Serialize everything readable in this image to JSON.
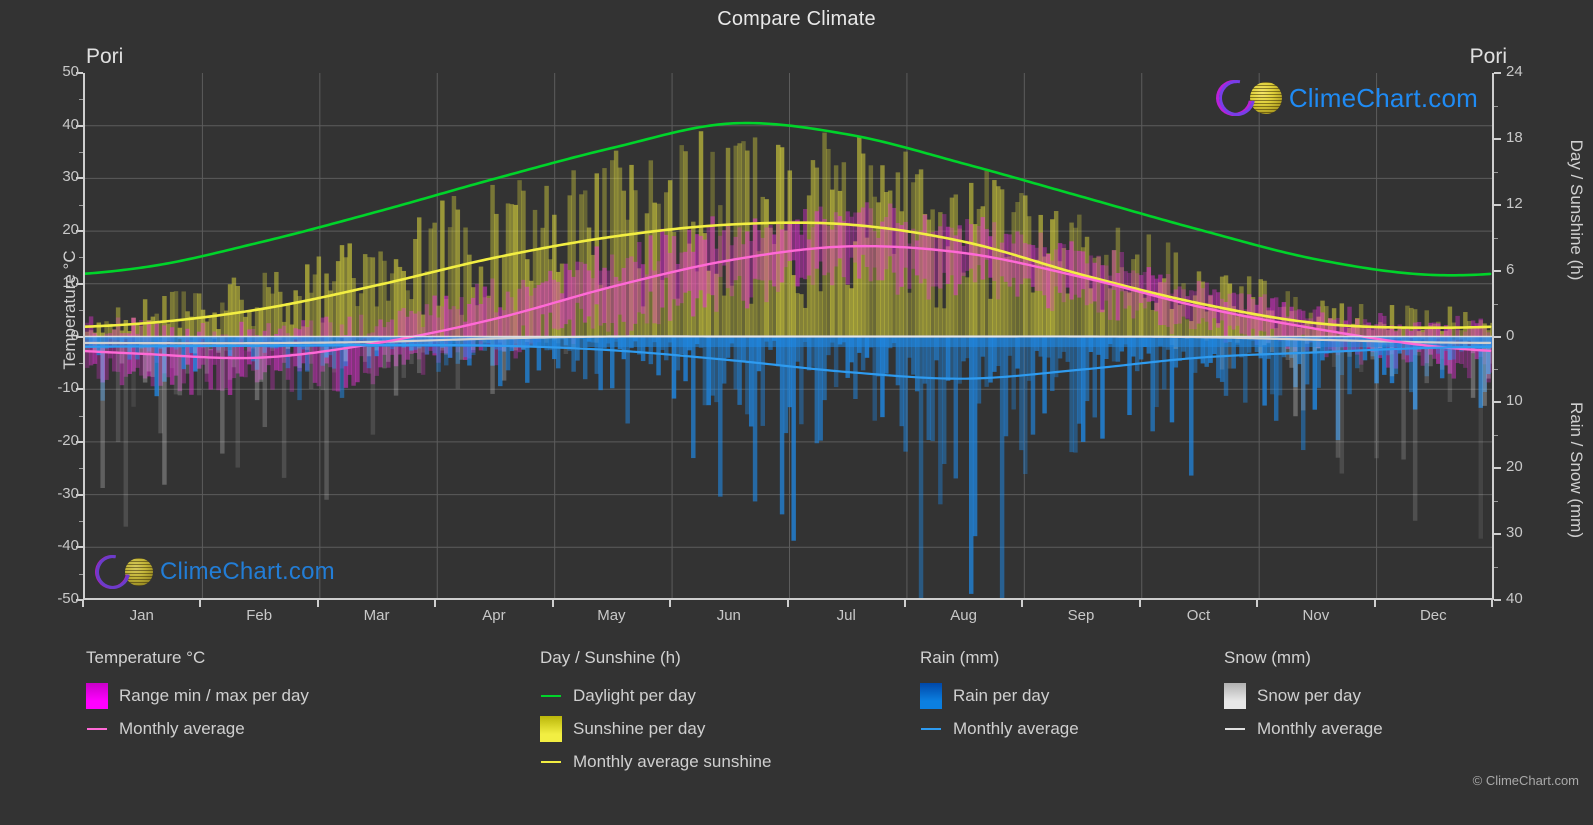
{
  "title": "Compare Climate",
  "location_left": "Pori",
  "location_right": "Pori",
  "copyright": "© ClimeChart.com",
  "watermark": {
    "text": "ClimeChart.com"
  },
  "axes": {
    "left_title": "Temperature °C",
    "right_title_top": "Day / Sunshine (h)",
    "right_title_bottom": "Rain / Snow (mm)",
    "left_ticks": [
      "50",
      "40",
      "30",
      "20",
      "10",
      "0",
      "-10",
      "-20",
      "-30",
      "-40",
      "-50"
    ],
    "right_ticks_top": [
      "24",
      "18",
      "12",
      "6",
      "0"
    ],
    "right_ticks_bottom": [
      "0",
      "10",
      "20",
      "30",
      "40"
    ],
    "x_ticks": [
      "Jan",
      "Feb",
      "Mar",
      "Apr",
      "May",
      "Jun",
      "Jul",
      "Aug",
      "Sep",
      "Oct",
      "Nov",
      "Dec"
    ]
  },
  "legend": [
    {
      "heading": "Temperature °C",
      "entries": [
        {
          "label": "Range min / max per day",
          "mark": "gradient",
          "color": "#ff00ff"
        },
        {
          "label": "Monthly average",
          "mark": "line",
          "color": "#ff69d6"
        }
      ]
    },
    {
      "heading": "Day / Sunshine (h)",
      "entries": [
        {
          "label": "Daylight per day",
          "mark": "line",
          "color": "#00d42a"
        },
        {
          "label": "Sunshine per day",
          "mark": "gradient",
          "color": "#f2ee42"
        },
        {
          "label": "Monthly average sunshine",
          "mark": "line",
          "color": "#f2ee42"
        }
      ]
    },
    {
      "heading": "Rain (mm)",
      "entries": [
        {
          "label": "Rain per day",
          "mark": "gradient",
          "color": "#0b7fe0"
        },
        {
          "label": "Monthly average",
          "mark": "line",
          "color": "#2e9bf0"
        }
      ]
    },
    {
      "heading": "Snow (mm)",
      "entries": [
        {
          "label": "Snow per day",
          "mark": "gradient",
          "color": "#e8e8e8"
        },
        {
          "label": "Monthly average",
          "mark": "line",
          "color": "#e0e0e0"
        }
      ]
    }
  ],
  "colors": {
    "background": "#333333",
    "plot_background": "#333333",
    "grid": "#5c5c5c",
    "axis": "#cfcfcf",
    "text": "#c8c8c8",
    "daylight": "#00d42a",
    "sunshine": "#f2ee42",
    "temperature_avg": "#ff69d6",
    "temperature_range": "#ff00ff",
    "rain": "#1f8ae8",
    "rain_avg": "#2e9bf0",
    "snow": "#cfcfcf",
    "logo_blue": "#1e90ff",
    "logo_magenta": "#c21fe0"
  },
  "chart_data": {
    "type": "line",
    "title": "Compare Climate",
    "subtitle": "Pori",
    "xlabel": "",
    "ylabel": "Temperature °C",
    "ylim": [
      -50,
      50
    ],
    "y2lim_day_sunshine": [
      0,
      24
    ],
    "y2lim_rain_snow": [
      0,
      40
    ],
    "grid": true,
    "legend_position": "bottom",
    "x": [
      "Jan",
      "Feb",
      "Mar",
      "Apr",
      "May",
      "Jun",
      "Jul",
      "Aug",
      "Sep",
      "Oct",
      "Nov",
      "Dec"
    ],
    "series": [
      {
        "name": "Daylight per day",
        "unit": "h",
        "axis": "day_sunshine",
        "color": "#00d42a",
        "values": [
          6.3,
          8.6,
          11.4,
          14.4,
          17.2,
          19.4,
          18.4,
          15.7,
          12.7,
          9.7,
          7.0,
          5.6
        ]
      },
      {
        "name": "Monthly average sunshine",
        "unit": "h",
        "axis": "day_sunshine",
        "color": "#f2ee42",
        "values": [
          1.2,
          2.5,
          4.7,
          7.2,
          9.1,
          10.2,
          10.2,
          8.6,
          5.6,
          3.0,
          1.2,
          0.8
        ]
      },
      {
        "name": "Monthly average temperature",
        "unit": "°C",
        "axis": "temperature",
        "color": "#ff69d6",
        "values": [
          -3.3,
          -4.0,
          -1.2,
          3.4,
          9.5,
          14.5,
          17.1,
          15.8,
          11.2,
          5.6,
          1.4,
          -1.9
        ]
      },
      {
        "name": "Monthly average rain",
        "unit": "mm",
        "axis": "rain_snow",
        "color": "#2e9bf0",
        "values": [
          1.5,
          1.4,
          1.3,
          1.4,
          2.1,
          3.6,
          5.4,
          6.4,
          5.0,
          3.2,
          2.4,
          1.7
        ]
      },
      {
        "name": "Monthly average snow",
        "unit": "mm",
        "axis": "rain_snow",
        "color": "#e0e0e0",
        "values": [
          1.0,
          1.0,
          0.8,
          0.3,
          0.0,
          0.0,
          0.0,
          0.0,
          0.0,
          0.1,
          0.5,
          0.9
        ]
      },
      {
        "name": "Temperature max per day",
        "unit": "°C",
        "axis": "temperature",
        "color": "#ff00ff",
        "values": [
          1.0,
          0.2,
          3.5,
          9.0,
          16.0,
          21.0,
          23.5,
          21.5,
          16.0,
          9.5,
          4.5,
          1.5
        ]
      },
      {
        "name": "Temperature min per day",
        "unit": "°C",
        "axis": "temperature",
        "color": "#ff00ff",
        "values": [
          -8.0,
          -9.0,
          -6.0,
          -1.5,
          4.0,
          9.0,
          12.0,
          11.0,
          7.0,
          2.0,
          -2.0,
          -6.0
        ]
      }
    ]
  }
}
